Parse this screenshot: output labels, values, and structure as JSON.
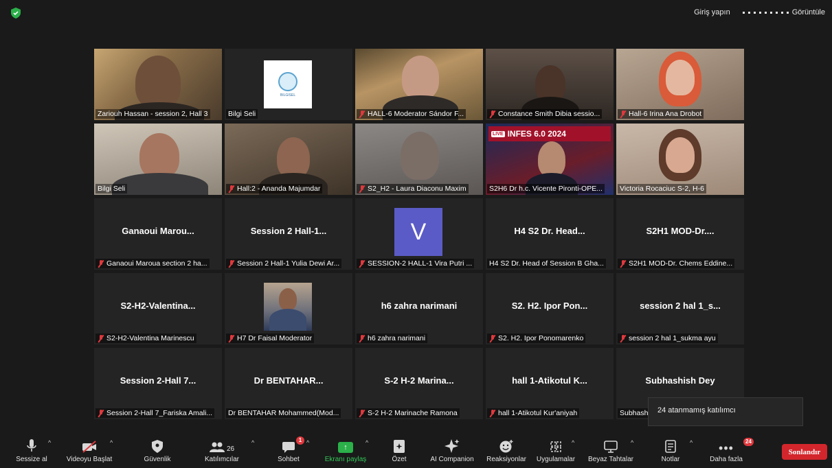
{
  "top": {
    "signin": "Giriş yapın",
    "view": "Görüntüle"
  },
  "tiles": [
    {
      "label": "Zariouh Hassan  - session 2, Hall 3",
      "muted": false,
      "big": ""
    },
    {
      "label": "Bilgi Seli",
      "muted": false,
      "big": ""
    },
    {
      "label": "HALL-6 Moderator Sándor F...",
      "muted": true,
      "big": ""
    },
    {
      "label": "Constance Smith Dibia sessio...",
      "muted": true,
      "big": ""
    },
    {
      "label": "Hall-6 Irina Ana Drobot",
      "muted": true,
      "big": ""
    },
    {
      "label": "Bilgi Seli",
      "muted": false,
      "big": ""
    },
    {
      "label": "Hall:2 - Ananda Majumdar",
      "muted": true,
      "big": ""
    },
    {
      "label": "S2_H2 - Laura Diaconu Maxim",
      "muted": true,
      "big": ""
    },
    {
      "label": "S2H6 Dr h.c. Vicente Pironti-OPE...",
      "muted": false,
      "big": ""
    },
    {
      "label": "Victoria Rocaciuc S-2, H-6",
      "muted": false,
      "big": ""
    },
    {
      "label": "Ganaoui Maroua section 2 ha...",
      "muted": true,
      "big": "Ganaoui  Marou..."
    },
    {
      "label": "Session 2 Hall-1 Yulia Dewi Ar...",
      "muted": true,
      "big": "Session 2 Hall-1..."
    },
    {
      "label": "SESSION-2 HALL-1 Vira Putri ...",
      "muted": true,
      "big": ""
    },
    {
      "label": "H4 S2 Dr. Head of Session B Gha...",
      "muted": false,
      "big": "H4 S2 Dr. Head..."
    },
    {
      "label": "S2H1 MOD-Dr. Chems Eddine...",
      "muted": true,
      "big": "S2H1  MOD-Dr...."
    },
    {
      "label": "S2-H2-Valentina Marinescu",
      "muted": true,
      "big": "S2-H2-Valentina..."
    },
    {
      "label": "H7 Dr Faisal Moderator",
      "muted": true,
      "big": ""
    },
    {
      "label": "h6 zahra narimani",
      "muted": true,
      "big": "h6 zahra narimani"
    },
    {
      "label": "S2. H2. Ipor Ponomarenko",
      "muted": true,
      "big": "S2. H2. Ipor Pon..."
    },
    {
      "label": "session 2 hal 1_sukma ayu",
      "muted": true,
      "big": "session 2 hal 1_s..."
    },
    {
      "label": "Session 2-Hall 7_Fariska Amali...",
      "muted": true,
      "big": "Session 2-Hall 7..."
    },
    {
      "label": "Dr BENTAHAR Mohammed(Mod...",
      "muted": false,
      "big": "Dr BENTAHAR..."
    },
    {
      "label": "S-2 H-2   Marinache Ramona",
      "muted": true,
      "big": "S-2  H-2    Marina..."
    },
    {
      "label": "hall 1-Atikotul Kur'aniyah",
      "muted": true,
      "big": "hall 1-Atikotul K..."
    },
    {
      "label": "Subhash",
      "muted": false,
      "big": "Subhashish Dey"
    }
  ],
  "avatar_letter": "V",
  "logo_text": "BILGISEL",
  "live": {
    "tag": "LIVE",
    "title": "INFES 6.0 2024"
  },
  "tooltip": "24 atanmamış katılımcı",
  "toolbar": {
    "mute": "Sessize al",
    "video": "Videoyu Başlat",
    "security": "Güvenlik",
    "participants": "Katılımcılar",
    "participants_count": "26",
    "chat": "Sohbet",
    "chat_badge": "1",
    "share": "Ekranı paylaş",
    "summary": "Özet",
    "ai": "AI Companion",
    "reactions": "Reaksiyonlar",
    "apps": "Uygulamalar",
    "whiteboard": "Beyaz Tahtalar",
    "notes": "Notlar",
    "more": "Daha fazla",
    "more_badge": "24",
    "end": "Sonlandır"
  },
  "colors": {
    "end": "#d3262c",
    "share": "#2bb04a",
    "active_speaker": "#d9d36a",
    "mute_red": "#e0393e"
  }
}
